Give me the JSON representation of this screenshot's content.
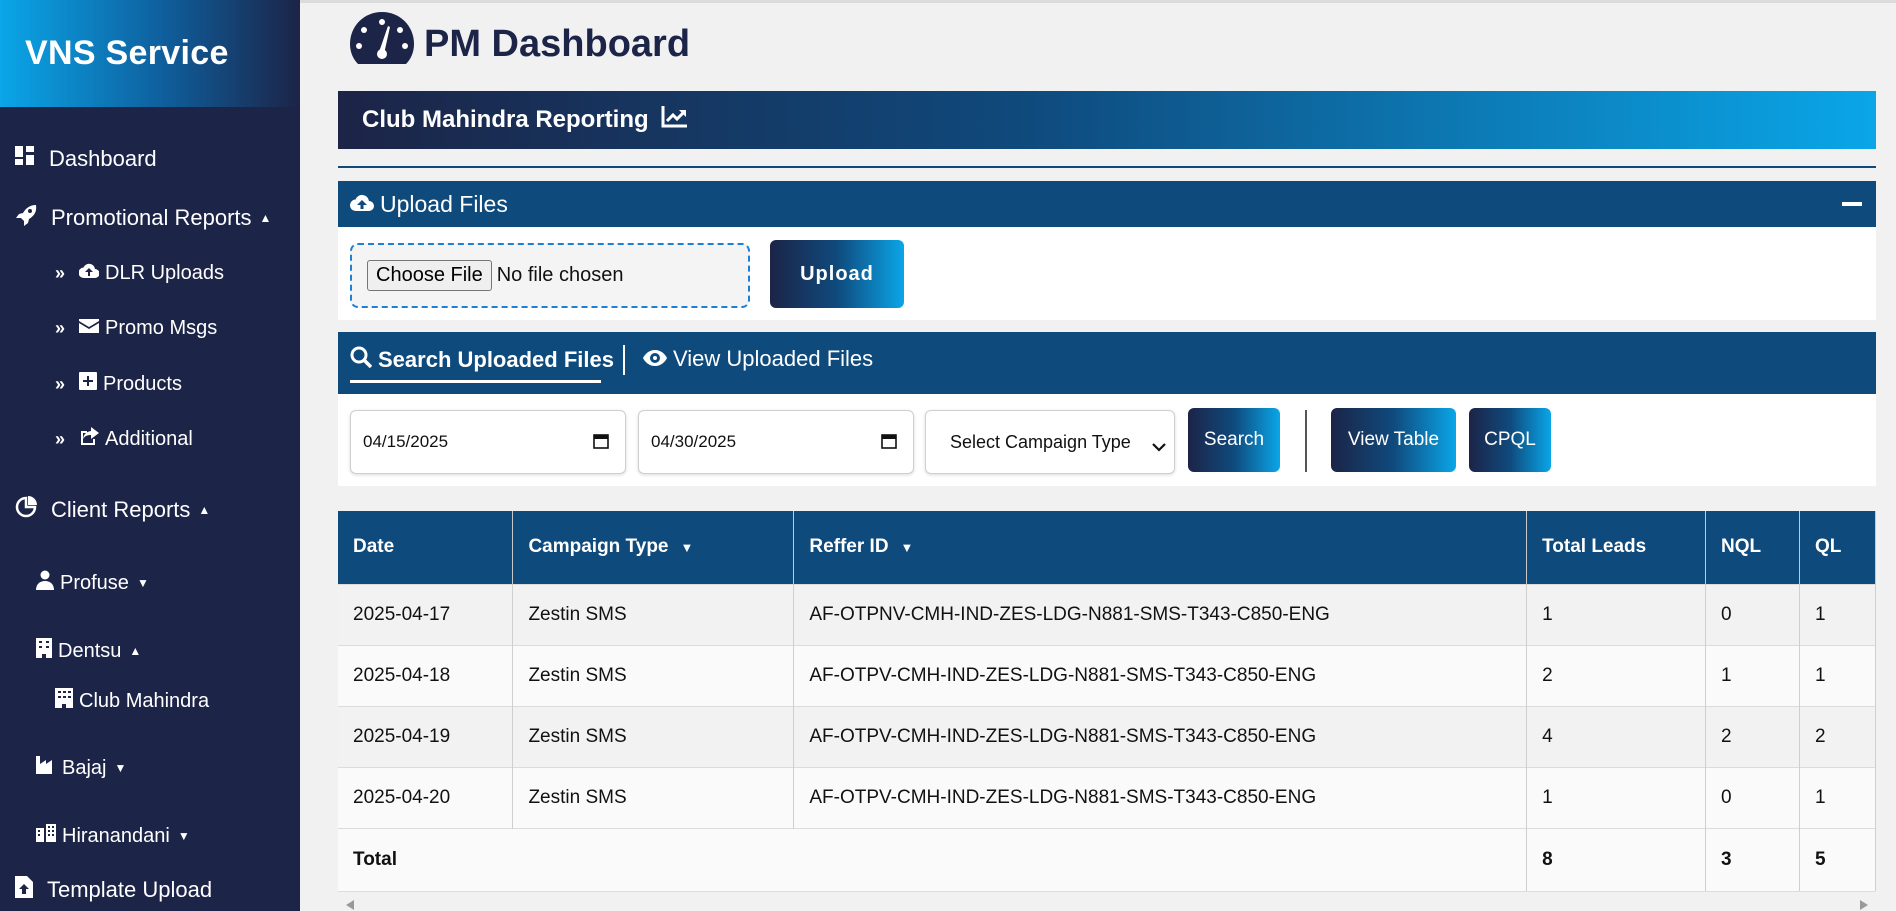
{
  "sidebar": {
    "brand": "VNS Service",
    "dashboard": "Dashboard",
    "promotional_reports": "Promotional Reports",
    "promo_items": [
      "DLR Uploads",
      "Promo Msgs",
      "Products",
      "Additional"
    ],
    "client_reports": "Client Reports",
    "profuse": "Profuse",
    "dentsu": "Dentsu",
    "club_mahindra": "Club Mahindra",
    "bajaj": "Bajaj",
    "hiranandani": "Hiranandani",
    "template_upload": "Template Upload"
  },
  "header": {
    "title": "PM Dashboard",
    "banner": "Club Mahindra Reporting"
  },
  "upload": {
    "panel_title": "Upload Files",
    "choose_label": "Choose File",
    "file_status": "No file chosen",
    "upload_label": "Upload"
  },
  "tabs": {
    "search": "Search Uploaded Files",
    "view": "View Uploaded Files"
  },
  "filters": {
    "start_date": "04/15/2025",
    "end_date": "04/30/2025",
    "campaign_type": "Select Campaign Type",
    "search_label": "Search",
    "view_table_label": "View Table",
    "cpql_label": "CPQL"
  },
  "table": {
    "headers": [
      "Date",
      "Campaign Type",
      "Reffer ID",
      "Total Leads",
      "NQL",
      "QL"
    ],
    "rows": [
      [
        "2025-04-17",
        "Zestin SMS",
        "AF-OTPNV-CMH-IND-ZES-LDG-N881-SMS-T343-C850-ENG",
        "1",
        "0",
        "1"
      ],
      [
        "2025-04-18",
        "Zestin SMS",
        "AF-OTPV-CMH-IND-ZES-LDG-N881-SMS-T343-C850-ENG",
        "2",
        "1",
        "1"
      ],
      [
        "2025-04-19",
        "Zestin SMS",
        "AF-OTPV-CMH-IND-ZES-LDG-N881-SMS-T343-C850-ENG",
        "4",
        "2",
        "2"
      ],
      [
        "2025-04-20",
        "Zestin SMS",
        "AF-OTPV-CMH-IND-ZES-LDG-N881-SMS-T343-C850-ENG",
        "1",
        "0",
        "1"
      ]
    ],
    "total": {
      "label": "Total",
      "total_leads": "8",
      "nql": "3",
      "ql": "5"
    }
  },
  "colors": {
    "sidebar_bg": "#1c2447",
    "accent_dark": "#0f4a7d",
    "accent_light": "#0aa6e8"
  }
}
